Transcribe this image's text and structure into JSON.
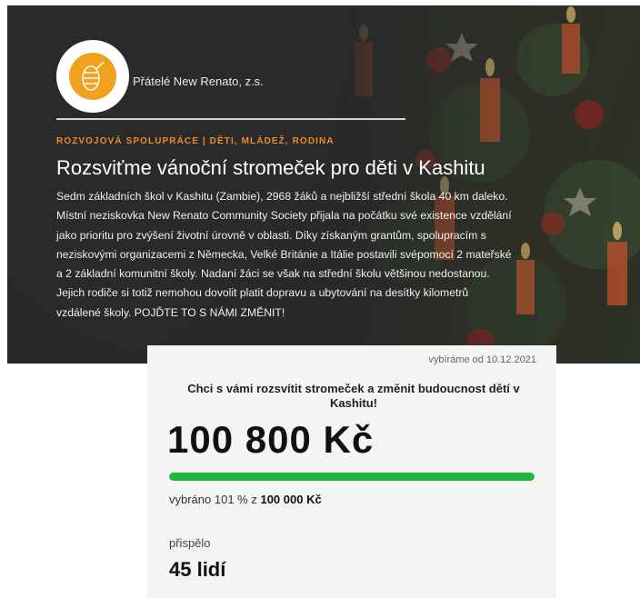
{
  "header": {
    "org_name": "Přátelé New Renato, z.s.",
    "category": "ROZVOJOVÁ SPOLUPRÁCE | DĚTI, MLÁDEŽ, RODINA",
    "title": "Rozsviťme vánoční stromeček pro děti v Kashitu",
    "description": "Sedm základních škol v Kashitu (Zambie), 2968 žáků a nejbližší střední škola 40 km daleko. Místní neziskovka New Renato Community Society přijala na počátku své existence vzdělání jako prioritu pro zvýšení životní úrovně v oblasti. Díky získaným grantům, spolupracím s neziskovými organizacemi z Německa, Velké Británie a Itálie postavili svépomocí 2 mateřské a 2 základní komunitní školy. Nadaní žáci se však na střední školu většinou nedostanou. Jejich rodiče si totiž nemohou dovolit platit dopravu a ubytování na desítky kilometrů vzdálené školy. POJĎTE TO S NÁMI ZMĚNIT!"
  },
  "card": {
    "since": "vybíráme od 10.12.2021",
    "headline": "Chci s vámi rozsvítit stromeček a změnit budoucnost dětí v Kashitu!",
    "amount": "100 800 Kč",
    "progress_fraction": 1.0,
    "collected_prefix": "vybráno 101 % z",
    "collected_goal": "100 000 Kč",
    "contributors_label": "přispělo",
    "contributors_count": "45 lidí"
  },
  "colors": {
    "accent_orange": "#f08a2a",
    "progress_green": "#1fb83a",
    "logo_orange": "#f0a21c"
  },
  "icons": {
    "logo": "pine-cone-logo-icon"
  }
}
